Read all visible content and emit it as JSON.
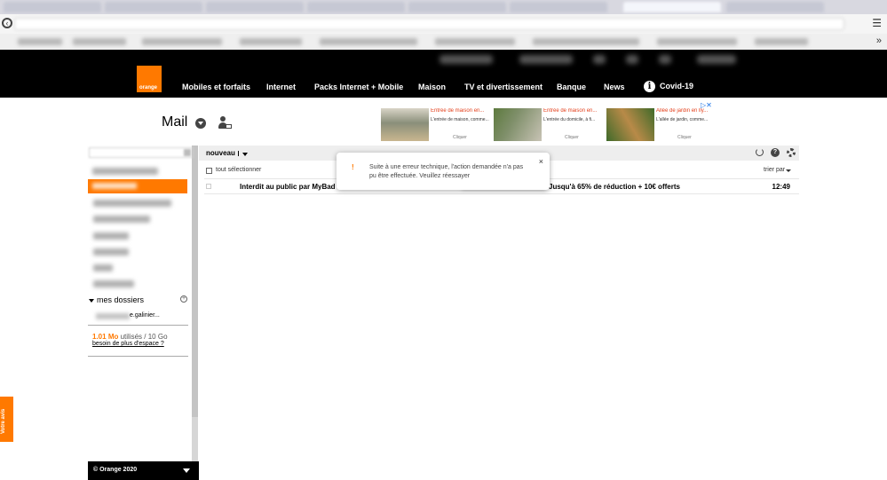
{
  "header": {
    "logo_text": "orange",
    "nav": [
      {
        "label": "Mobiles et forfaits"
      },
      {
        "label": "Internet"
      },
      {
        "label": "Packs Internet + Mobile"
      },
      {
        "label": "Maison"
      },
      {
        "label": "TV et divertissement"
      },
      {
        "label": "Banque"
      },
      {
        "label": "News"
      },
      {
        "label": "Covid-19",
        "icon": "info-icon"
      }
    ],
    "info_glyph": "i"
  },
  "mail": {
    "title": "Mail"
  },
  "ads": {
    "choices_glyph": "▷✕",
    "items": [
      {
        "title": "Entrée de maison en...",
        "desc": "L'entrée de maison, comme...",
        "cta": "Cliquer",
        "colors": [
          "#8a8f7a",
          "#c9b68f"
        ]
      },
      {
        "title": "Entrée de maison en...",
        "desc": "L'entrée du domicile, à fi...",
        "cta": "Cliquer",
        "colors": [
          "#5d7a3e",
          "#c8c3b5"
        ]
      },
      {
        "title": "Allée de jardin en lly...",
        "desc": "L'allée de jardin, comme...",
        "cta": "Cliquer",
        "colors": [
          "#3f6a2a",
          "#b88a48"
        ]
      }
    ]
  },
  "sidebar": {
    "mes_dossiers": "mes dossiers",
    "add_glyph": "+",
    "folder_sub": "e.galinier...",
    "storage": {
      "used": "1.01",
      "unit": "Mo",
      "rest": " utilisés / 10 Go"
    },
    "storage_link": "besoin de plus d'espace ?",
    "feedback": "Votre avis",
    "footer": "© Orange 2020"
  },
  "toolbar": {
    "new_label": "nouveau",
    "select_all": "tout sélectionner",
    "sort": "trier par",
    "help_glyph": "?"
  },
  "messages": [
    {
      "sender": "Interdit au public par MyBad",
      "subject": "Jusqu'à 65% de réduction + 10€ offerts",
      "time": "12:49"
    }
  ],
  "toast": {
    "warning": "!",
    "text": "Suite à une erreur technique, l'action demandée n'a pas pu être effectuée. Veuillez réessayer",
    "close": "×"
  },
  "colors": {
    "brand": "#ff7900",
    "header_bg": "#000000"
  }
}
